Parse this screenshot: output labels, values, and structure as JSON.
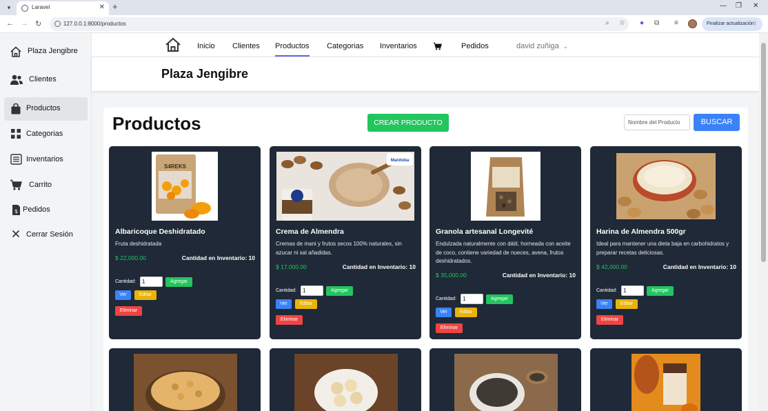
{
  "browser": {
    "tab_title": "Laravel",
    "url": "127.0.0.1:8000/productos",
    "update_button": "Finalizar actualización"
  },
  "sidebar": {
    "items": [
      {
        "label": "Plaza Jengibre",
        "icon": "house-icon"
      },
      {
        "label": "Clientes",
        "icon": "users-icon"
      },
      {
        "label": "Productos",
        "icon": "shopping-bag-icon",
        "active": true
      },
      {
        "label": "Categorias",
        "icon": "grid-icon"
      },
      {
        "label": "Inventarios",
        "icon": "list-icon"
      },
      {
        "label": "Carrito",
        "icon": "cart-icon"
      },
      {
        "label": "Pedidos",
        "icon": "receipt-icon"
      },
      {
        "label": "Cerrar Sesión",
        "icon": "close-icon"
      }
    ]
  },
  "topnav": {
    "links": [
      "Inicio",
      "Clientes",
      "Productos",
      "Categorias",
      "Inventarios",
      "Pedidos"
    ],
    "active": "Productos",
    "user": "david zuñiga"
  },
  "header": {
    "title": "Plaza Jengibre"
  },
  "main": {
    "title": "Productos",
    "create_button": "CREAR PRODUCTO",
    "search_placeholder": "Nombre del Producto",
    "search_button": "BUSCAR"
  },
  "card_labels": {
    "quantity": "Cantidad:",
    "add": "Agregar",
    "view": "Ver",
    "edit": "Editar",
    "delete": "Eliminar",
    "qty_value": "1"
  },
  "products": [
    {
      "name": "Albaricoque Deshidratado",
      "description": "Fruta deshidratada",
      "price": "$ 22,000.00",
      "stock": "Cantidad en Inventario: 10",
      "image": "dried-apricots-package-image",
      "image_label": "S4REKS"
    },
    {
      "name": "Crema de Almendra",
      "description": "Cremas de mani y frutos secos 100% naturales, sin azucar ni sal añadidas.",
      "price": "$ 17,000.00",
      "stock": "Cantidad en Inventario: 10",
      "image": "almond-butter-jar-image",
      "image_label": "Manitoba"
    },
    {
      "name": "Granola artesanal Longevité",
      "description": "Endulzada naturalmente con dátil, horneada con aceite de coco, contiene variedad de nueces, avena, frutos deshidratados.",
      "price": "$ 35,000.00",
      "stock": "Cantidad en Inventario: 10",
      "image": "granola-bag-image",
      "image_label": ""
    },
    {
      "name": "Harina de Almendra 500gr",
      "description": "Ideal para mantener una dieta baja en carbohidratos y preparar recetas deliciosas.",
      "price": "$ 42,000.00",
      "stock": "Cantidad en Inventario: 10",
      "image": "almond-flour-bowl-image",
      "image_label": ""
    }
  ],
  "products_row2": [
    {
      "image": "peanuts-bowl-image"
    },
    {
      "image": "macadamia-bowl-image"
    },
    {
      "image": "chia-seeds-bowl-image"
    },
    {
      "image": "cacao-chocolate-image"
    }
  ],
  "colors": {
    "card_bg": "#1f2937",
    "green": "#22c55e",
    "blue": "#3b82f6",
    "yellow": "#eab308",
    "red": "#ef4444",
    "nav_active": "#6366f1"
  }
}
